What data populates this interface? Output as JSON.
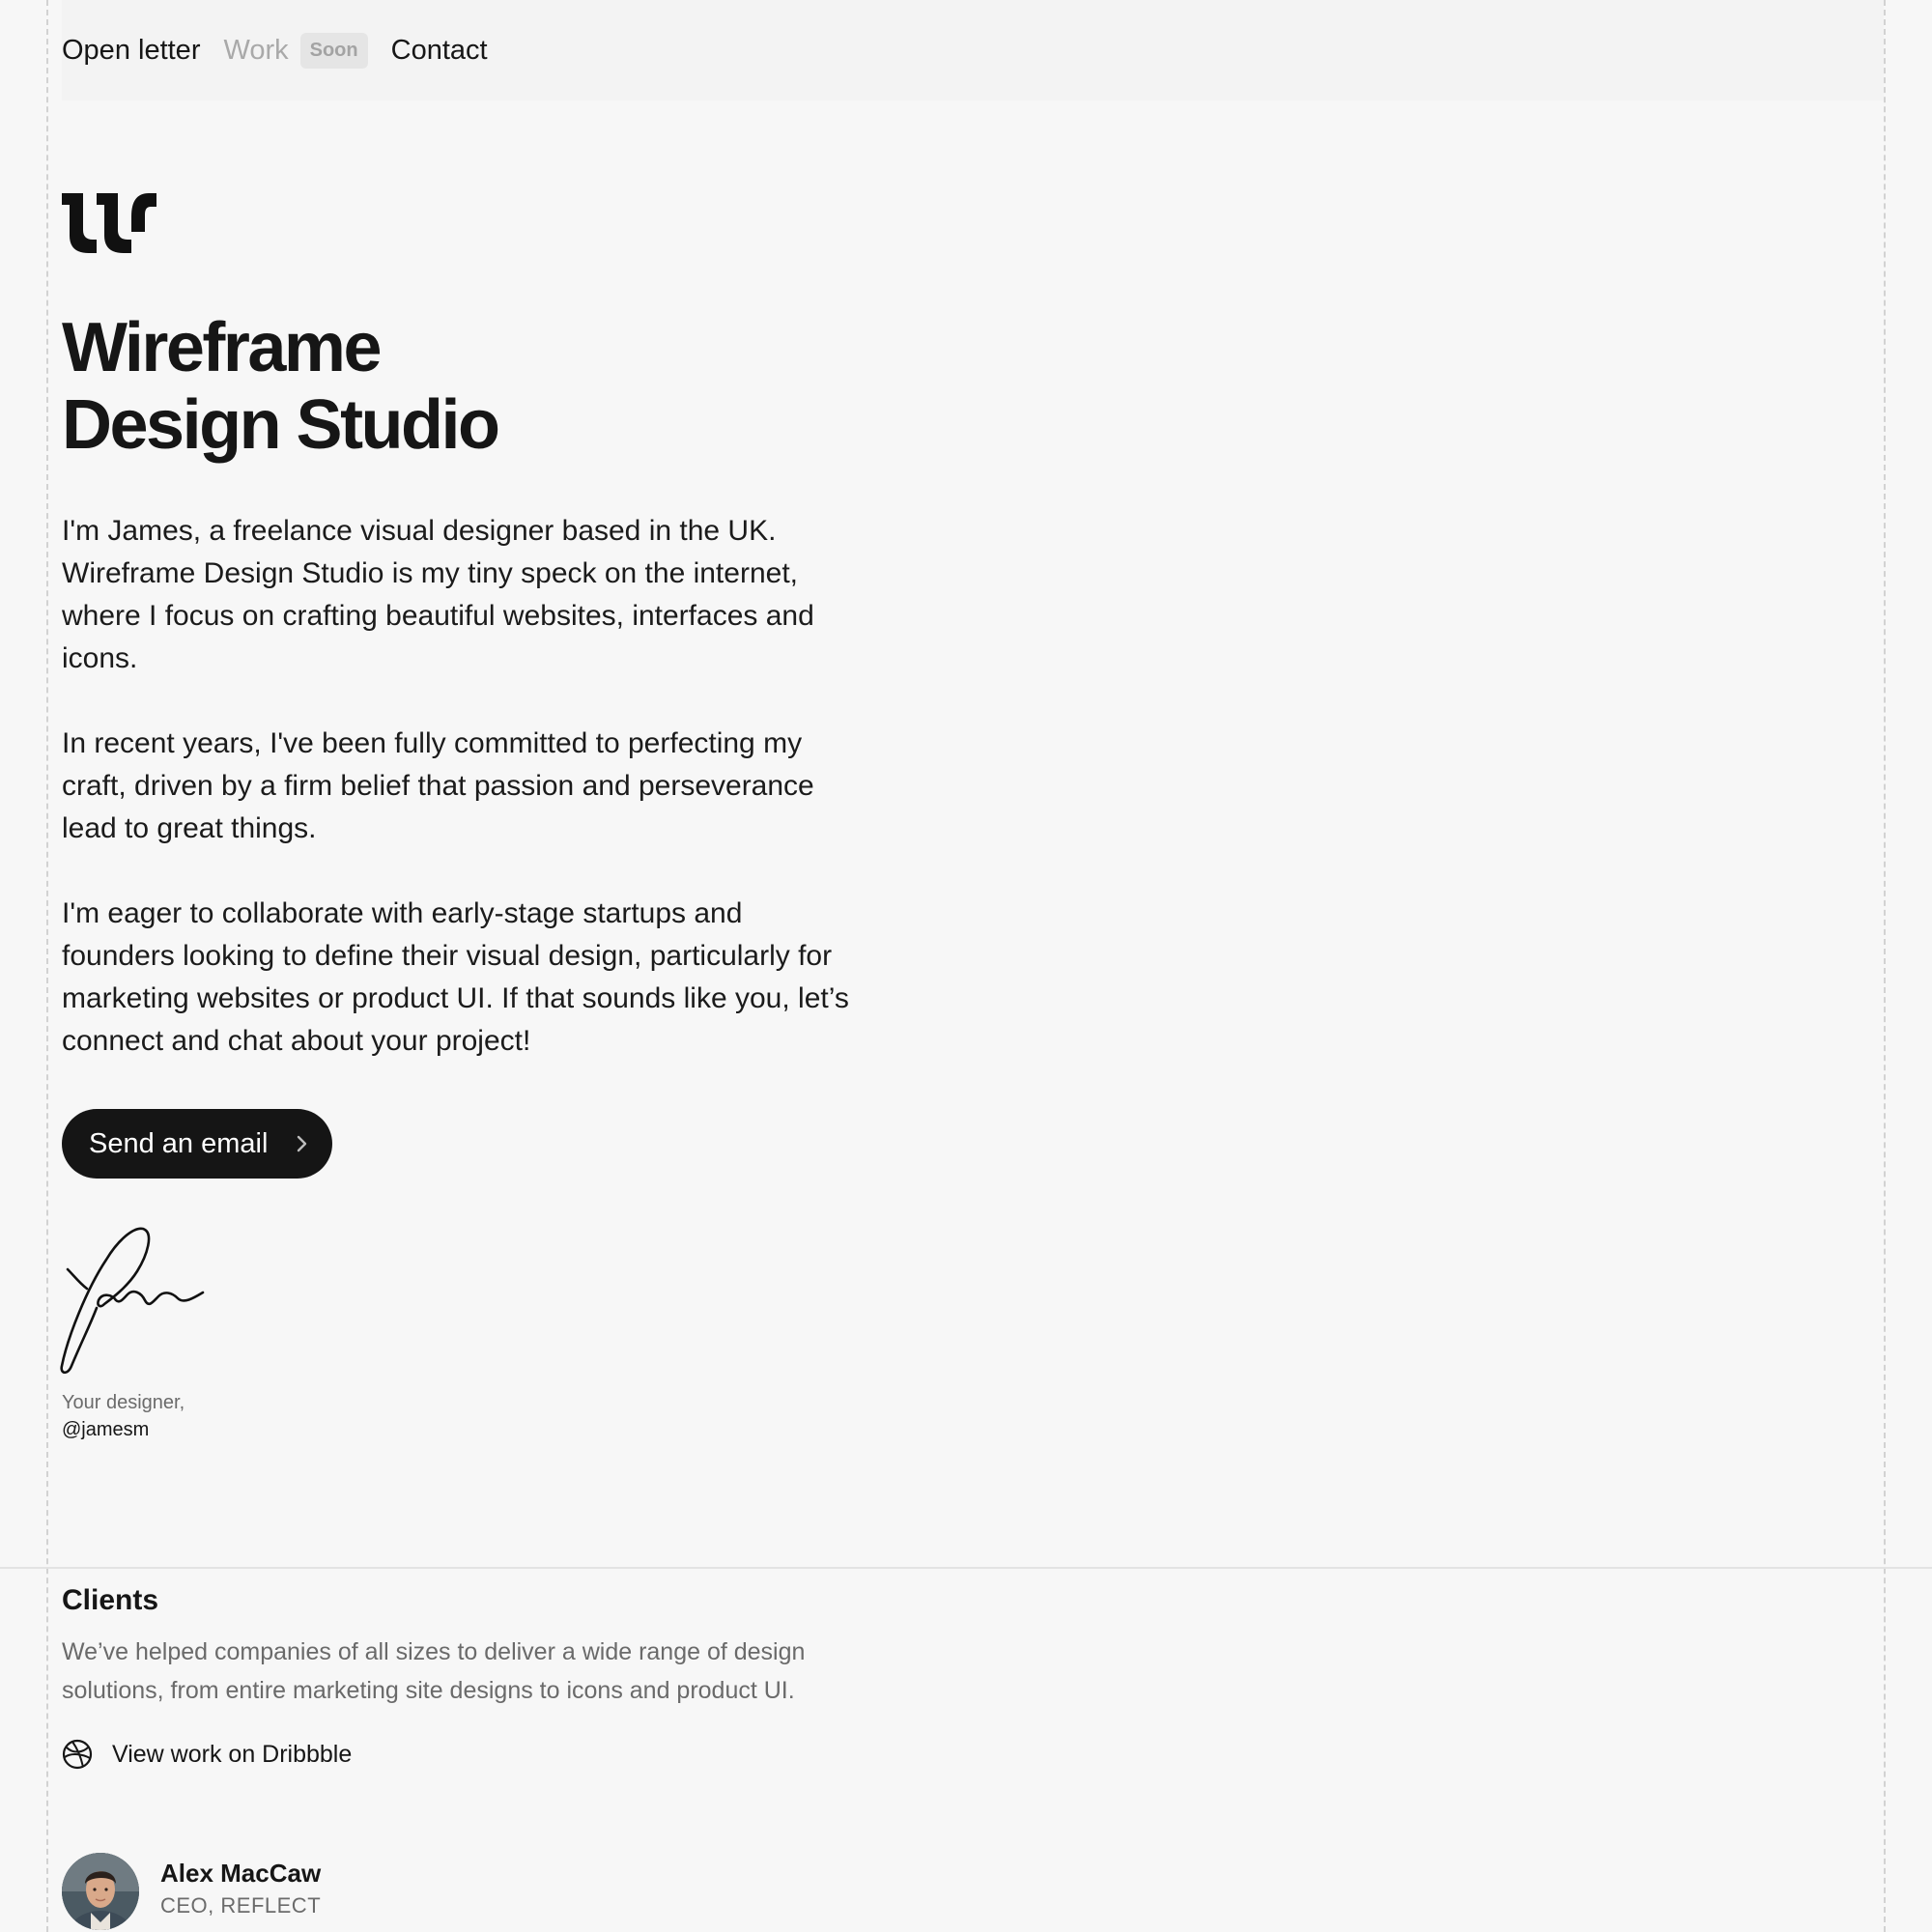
{
  "nav": {
    "open_letter": "Open letter",
    "work": "Work",
    "work_badge": "Soon",
    "contact": "Contact"
  },
  "hero": {
    "logo_icon": "studio-logo-icon",
    "title_line1": "Wireframe",
    "title_line2": "Design Studio",
    "paragraphs": [
      "I'm James, a freelance visual designer based in the UK. Wireframe Design Studio is my tiny speck on the internet, where I focus on crafting beautiful websites, interfaces and icons.",
      "In recent years, I've been fully committed to perfecting my craft, driven by a firm belief that passion and perseverance lead to great things.",
      "I'm eager to collaborate with early-stage startups and founders looking to define their visual design, particularly for marketing websites or product UI. If that sounds like you, let’s connect and chat about your project!"
    ],
    "cta_label": "Send an email",
    "cta_icon": "chevron-right-icon"
  },
  "signoff": {
    "lead": "Your designer,",
    "handle": "@jamesm"
  },
  "clients": {
    "title": "Clients",
    "description": "We’ve helped companies of all sizes to deliver a wide range of design solutions, from entire marketing site designs to icons and product UI.",
    "dribbble_label": "View work on Dribbble",
    "dribbble_icon": "dribbble-icon",
    "items": [
      {
        "name": "Alex MacCaw",
        "role": "CEO, REFLECT"
      }
    ]
  },
  "colors": {
    "background": "#f7f7f7",
    "text": "#161616",
    "muted": "#a9a9a9",
    "button": "#151515"
  }
}
